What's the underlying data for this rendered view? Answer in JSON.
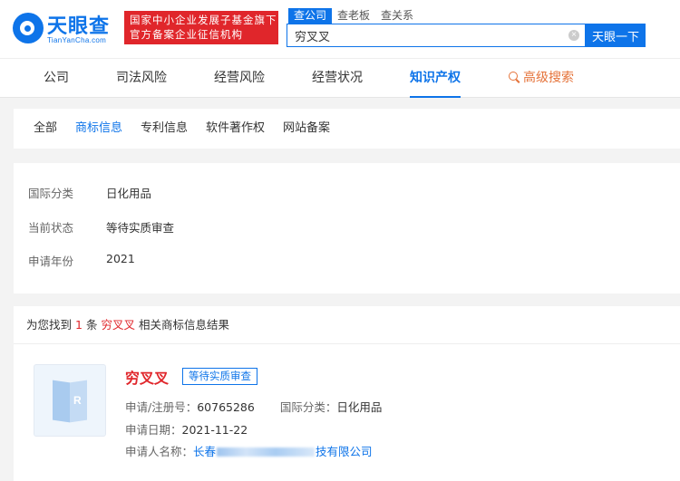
{
  "brand": {
    "logo_name": "天眼查",
    "logo_domain": "TianYanCha.com",
    "gov_line1": "国家中小企业发展子基金旗下",
    "gov_line2": "官方备案企业征信机构",
    "brand_color": "#0e74e9"
  },
  "search": {
    "tabs": [
      "查公司",
      "查老板",
      "查关系"
    ],
    "active_tab": "查公司",
    "query": "穷叉叉",
    "button_label": "天眼一下",
    "clear_icon": "close-icon"
  },
  "nav": {
    "items": [
      "公司",
      "司法风险",
      "经营风险",
      "经营状况",
      "知识产权"
    ],
    "active": "知识产权",
    "advanced_label": "高级搜索",
    "advanced_icon": "magnifier-icon"
  },
  "subnav": {
    "items": [
      "全部",
      "商标信息",
      "专利信息",
      "软件著作权",
      "网站备案"
    ],
    "active": "商标信息"
  },
  "filter": {
    "rows": [
      {
        "label": "国际分类",
        "value": "日化用品"
      },
      {
        "label": "当前状态",
        "value": "等待实质审查"
      },
      {
        "label": "申请年份",
        "value": "2021"
      }
    ]
  },
  "results": {
    "prefix": "为您找到",
    "count": "1",
    "unit": "条",
    "keyword": "穷叉叉",
    "suffix": "相关商标信息结果"
  },
  "trademark": {
    "name": "穷叉叉",
    "status": "等待实质审查",
    "reg_label": "申请/注册号：",
    "reg_no": "60765286",
    "class_label": "国际分类：",
    "class_value": "日化用品",
    "date_label": "申请日期：",
    "date_value": "2021-11-22",
    "applicant_label": "申请人名称：",
    "applicant_prefix": "长春",
    "applicant_suffix": "技有限公司",
    "image_letter": "R",
    "image_icon": "trademark-book-icon",
    "highlight_color": "#e0262b"
  }
}
